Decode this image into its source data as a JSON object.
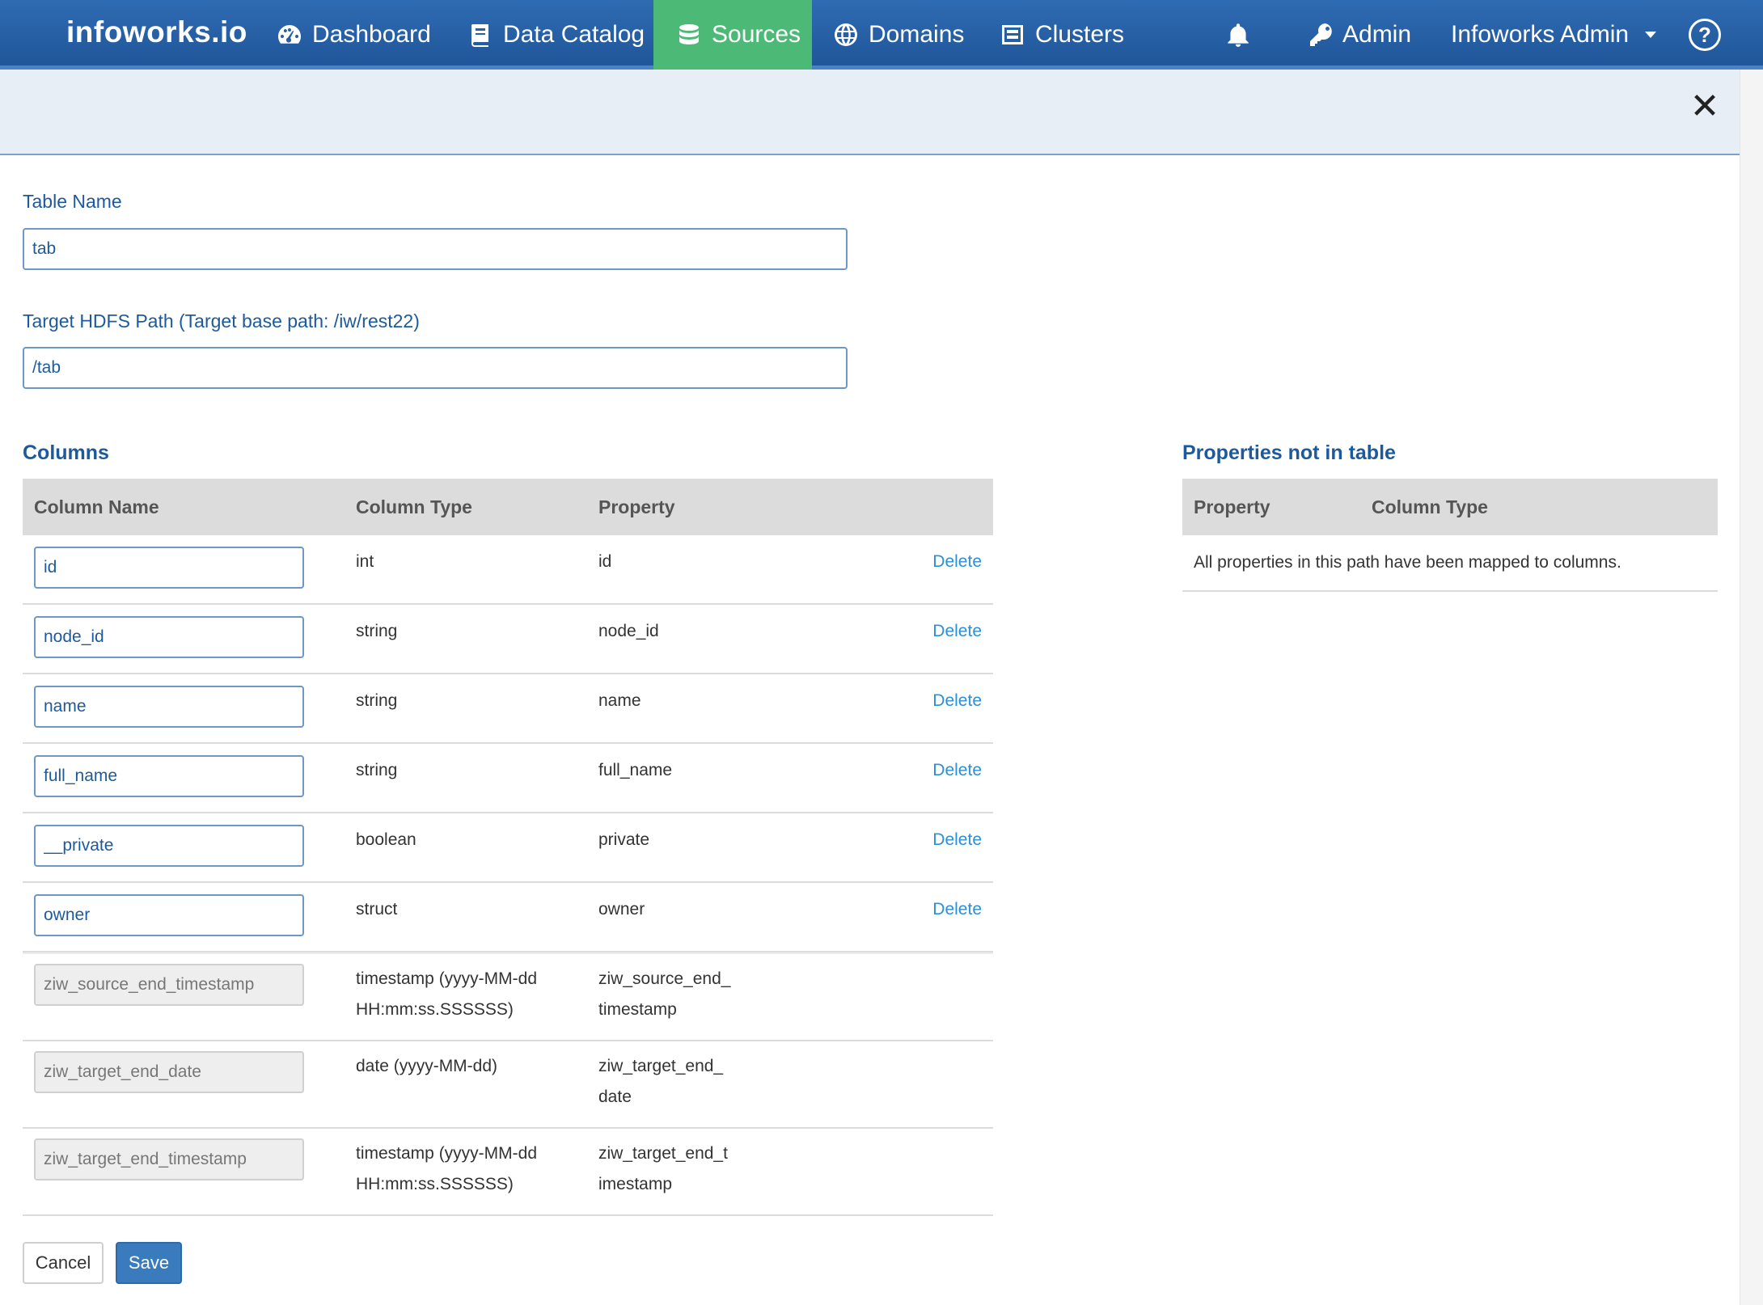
{
  "navbar": {
    "brand": "infoworks.io",
    "items": [
      {
        "label": "Dashboard",
        "icon": "dashboard-gauge-icon",
        "active": false
      },
      {
        "label": "Data Catalog",
        "icon": "book-icon",
        "active": false
      },
      {
        "label": "Sources",
        "icon": "database-icon",
        "active": true
      },
      {
        "label": "Domains",
        "icon": "globe-icon",
        "active": false
      },
      {
        "label": "Clusters",
        "icon": "server-icon",
        "active": false
      }
    ],
    "notifications_icon": "bell-icon",
    "admin_label": "Admin",
    "admin_icon": "key-icon",
    "user_label": "Infoworks Admin",
    "help_icon": "question-circle-icon",
    "help_glyph": "?",
    "active_color": "#4db976"
  },
  "subheader": {
    "close_icon": "close-icon",
    "close_glyph": "✕"
  },
  "form": {
    "table_name_label": "Table Name",
    "table_name_value": "tab",
    "target_path_label": "Target HDFS Path (Target base path: /iw/rest22)",
    "target_path_value": "/tab"
  },
  "columns": {
    "title": "Columns",
    "headers": {
      "name": "Column Name",
      "type": "Column Type",
      "property": "Property"
    },
    "delete_label": "Delete",
    "rows": [
      {
        "name": "id",
        "type": "int",
        "property": "id",
        "editable": true
      },
      {
        "name": "node_id",
        "type": "string",
        "property": "node_id",
        "editable": true
      },
      {
        "name": "name",
        "type": "string",
        "property": "name",
        "editable": true
      },
      {
        "name": "full_name",
        "type": "string",
        "property": "full_name",
        "editable": true
      },
      {
        "name": "__private",
        "type": "boolean",
        "property": "private",
        "editable": true
      },
      {
        "name": "owner",
        "type": "struct",
        "property": "owner",
        "editable": true
      },
      {
        "name": "ziw_source_end_timestamp",
        "type": "timestamp (yyyy-MM-dd\nHH:mm:ss.SSSSSS)",
        "property": "ziw_source_end_\ntimestamp",
        "editable": false
      },
      {
        "name": "ziw_target_end_date",
        "type": "date (yyyy-MM-dd)",
        "property": "ziw_target_end_\ndate",
        "editable": false
      },
      {
        "name": "ziw_target_end_timestamp",
        "type": "timestamp (yyyy-MM-dd\nHH:mm:ss.SSSSSS)",
        "property": "ziw_target_end_t\nimestamp",
        "editable": false
      }
    ]
  },
  "properties": {
    "title": "Properties not in table",
    "headers": {
      "property": "Property",
      "type": "Column Type"
    },
    "empty_message": "All properties in this path have been mapped to columns."
  },
  "buttons": {
    "cancel": "Cancel",
    "save": "Save"
  }
}
